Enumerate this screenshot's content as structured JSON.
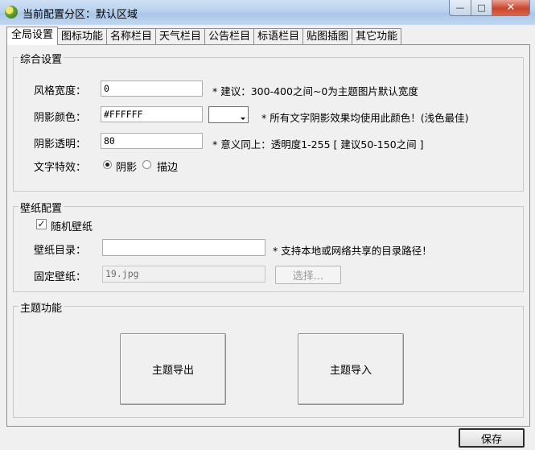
{
  "window": {
    "title": "当前配置分区：默认区域",
    "minimize": "—",
    "maximize": "□",
    "close": "✕"
  },
  "tabs": [
    {
      "label": "全局设置",
      "active": true
    },
    {
      "label": "图标功能"
    },
    {
      "label": "名称栏目"
    },
    {
      "label": "天气栏目"
    },
    {
      "label": "公告栏目"
    },
    {
      "label": "标语栏目"
    },
    {
      "label": "贴图插图"
    },
    {
      "label": "其它功能"
    }
  ],
  "general": {
    "title": "综合设置",
    "style_width": {
      "label": "风格宽度：",
      "value": "0",
      "note": "* 建议：300-400之间~0为主题图片默认宽度"
    },
    "shadow_color": {
      "label": "阴影颜色：",
      "value": "#FFFFFF",
      "note": "* 所有文字阴影效果均使用此颜色！(浅色最佳)"
    },
    "shadow_opacity": {
      "label": "阴影透明：",
      "value": "80",
      "note": "* 意义同上：透明度1-255 [ 建议50-150之间 ]"
    },
    "text_effect": {
      "label": "文字特效：",
      "options": [
        "阴影",
        "描边"
      ],
      "selected": "阴影"
    }
  },
  "wallpaper": {
    "title": "壁纸配置",
    "random": {
      "label": "随机壁纸",
      "checked": true
    },
    "directory": {
      "label": "壁纸目录：",
      "value": "",
      "note": "* 支持本地或网络共享的目录路径！"
    },
    "fixed": {
      "label": "固定壁纸：",
      "value": "19.jpg",
      "button": "选择..."
    }
  },
  "theme": {
    "title": "主题功能",
    "export_button": "主题导出",
    "import_button": "主题导入"
  },
  "footer": {
    "save_button": "保存"
  },
  "colors": {
    "titlebar": "#b9d1ee",
    "panel": "#f0f0f0",
    "close_button": "#c9462c"
  }
}
